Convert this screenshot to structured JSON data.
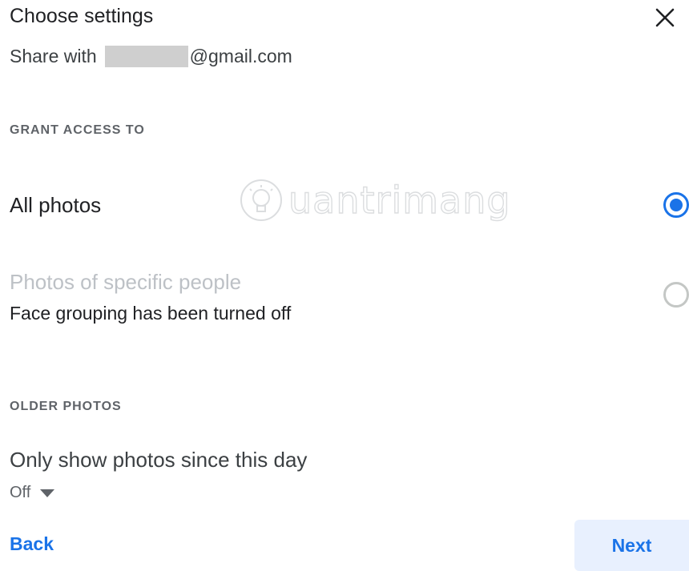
{
  "dialog": {
    "title": "Choose settings",
    "close_icon": "close-icon",
    "share_prefix": "Share with",
    "share_email_suffix": "@gmail.com"
  },
  "grant_access": {
    "section_label": "GRANT ACCESS TO",
    "options": [
      {
        "label": "All photos",
        "selected": true,
        "enabled": true
      },
      {
        "label": "Photos of specific people",
        "sublabel": "Face grouping has been turned off",
        "selected": false,
        "enabled": false
      }
    ]
  },
  "older_photos": {
    "section_label": "OLDER PHOTOS",
    "label": "Only show photos since this day",
    "dropdown_value": "Off",
    "dropdown_icon": "caret-down-icon"
  },
  "footer": {
    "back_label": "Back",
    "next_label": "Next"
  },
  "watermark": {
    "text": "uantrimang",
    "icon": "lightbulb-icon"
  },
  "colors": {
    "accent": "#1a73e8",
    "next_bg": "#e8f0fe",
    "disabled_text": "#bdc1c6",
    "secondary_text": "#5f6368"
  }
}
